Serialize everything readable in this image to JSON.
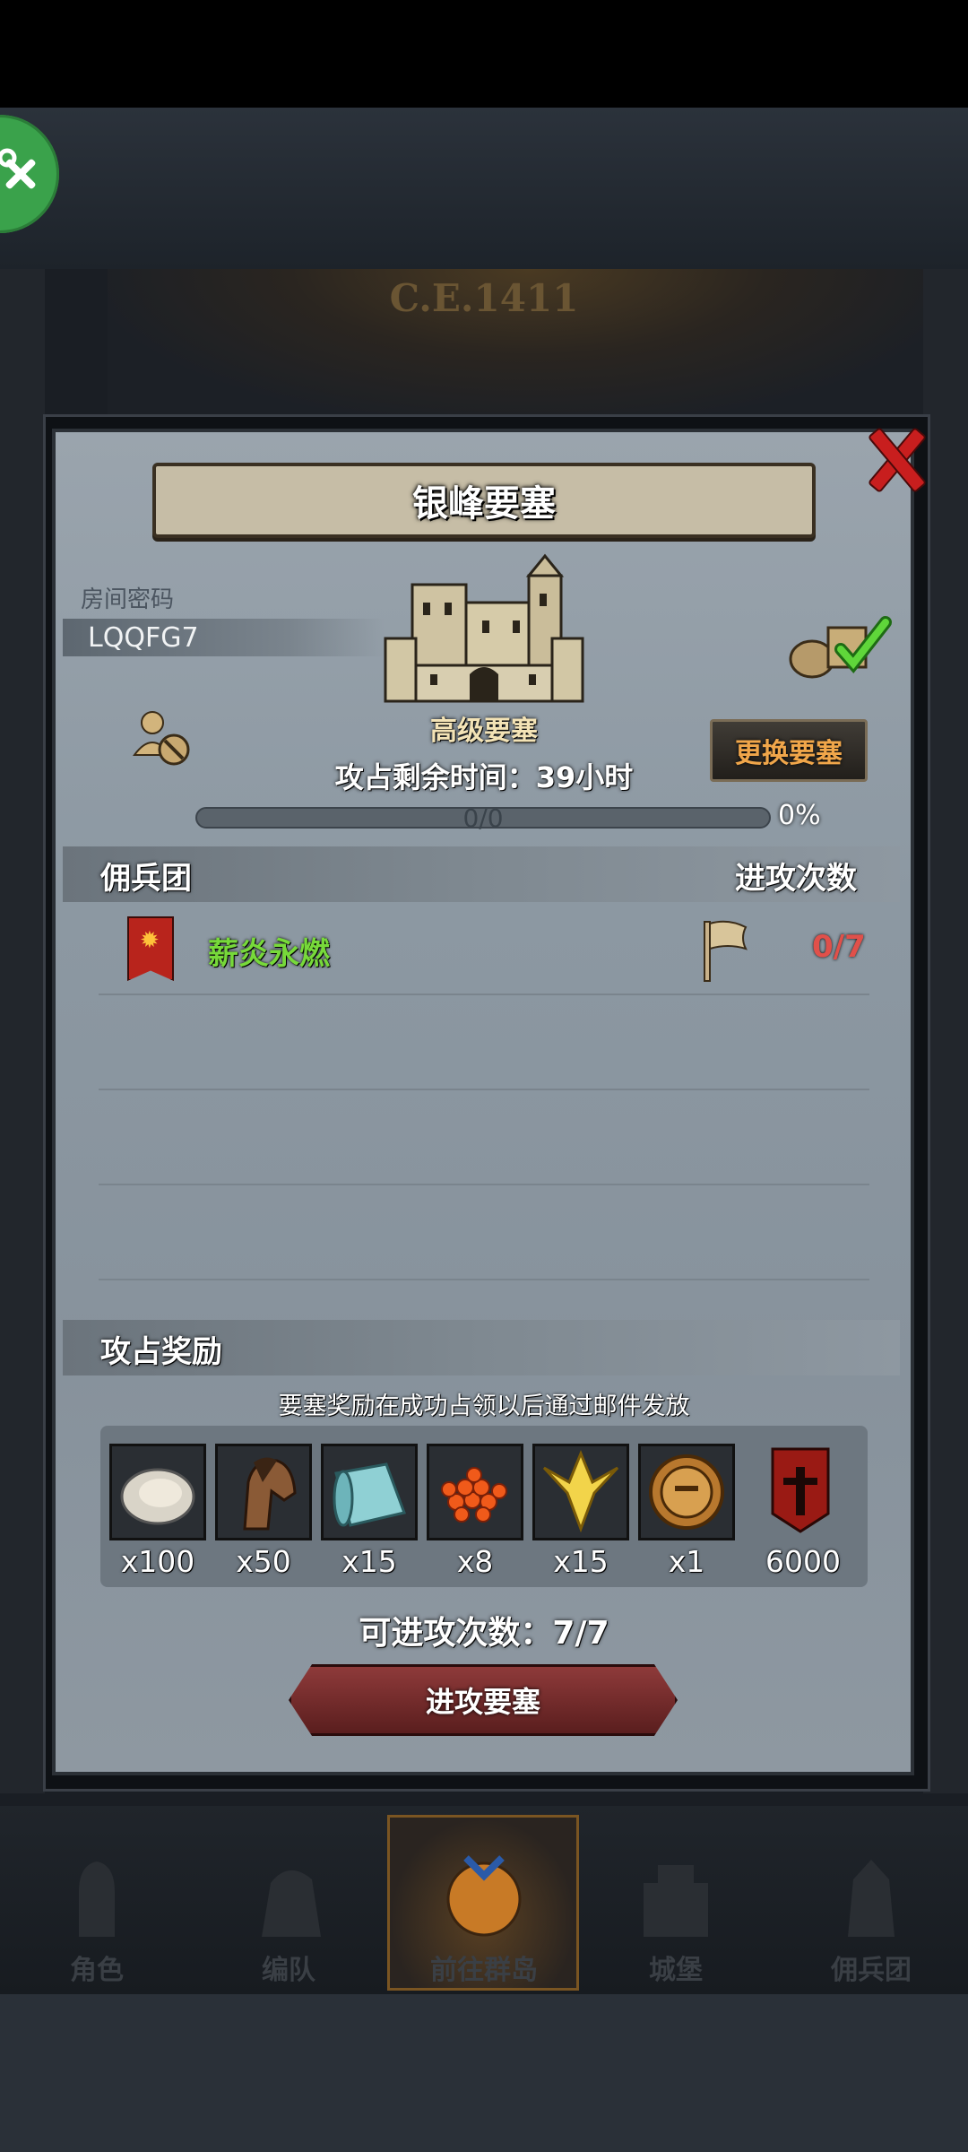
{
  "header": {
    "era_label": "C.E.1411"
  },
  "fortress": {
    "title": "银峰要塞",
    "room_code_label": "房间密码",
    "room_code": "LQQFG7",
    "castle_name": "高级要塞",
    "change_button": "更换要塞",
    "time_remaining": "攻占剩余时间：39小时",
    "progress_text": "0/0",
    "progress_percent": "0%",
    "progress_fraction": 0
  },
  "guild_section": {
    "title": "佣兵团",
    "attacks_header": "进攻次数",
    "rows": [
      {
        "name": "薪炎永燃",
        "attacks": "0/7"
      }
    ]
  },
  "rewards_section": {
    "title": "攻占奖励",
    "note": "要塞奖励在成功占领以后通过邮件发放",
    "items": [
      {
        "icon": "oyster-icon",
        "qty": "x100"
      },
      {
        "icon": "horse-icon",
        "qty": "x50"
      },
      {
        "icon": "cloth-roll-icon",
        "qty": "x15"
      },
      {
        "icon": "caviar-icon",
        "qty": "x8"
      },
      {
        "icon": "golden-crest-icon",
        "qty": "x15"
      },
      {
        "icon": "knight-medal-icon",
        "qty": "x1"
      },
      {
        "icon": "guild-banner-icon",
        "qty": "6000"
      }
    ]
  },
  "attack": {
    "attacks_left": "可进攻次数：7/7",
    "button": "进攻要塞"
  },
  "bottom_nav": [
    {
      "label": "角色",
      "icon": "knight-icon"
    },
    {
      "label": "编队",
      "icon": "formation-icon"
    },
    {
      "label": "前往群岛",
      "icon": "globe-icon",
      "active": true
    },
    {
      "label": "城堡",
      "icon": "castle-icon"
    },
    {
      "label": "佣兵团",
      "icon": "mercenary-icon"
    }
  ],
  "colors": {
    "accent_green": "#77d93a",
    "accent_red": "#e0504a",
    "gold": "#f0a64a"
  }
}
